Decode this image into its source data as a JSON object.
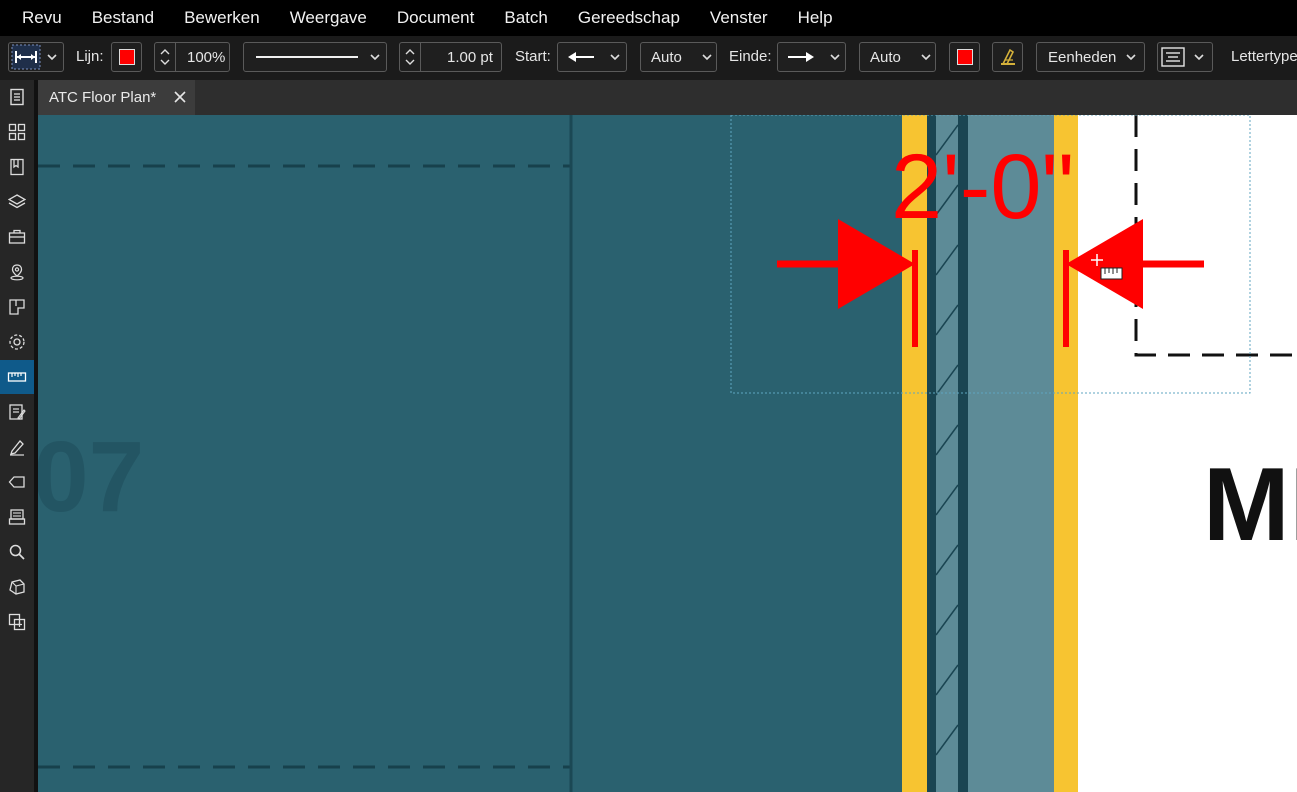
{
  "menubar": {
    "items": [
      "Revu",
      "Bestand",
      "Bewerken",
      "Weergave",
      "Document",
      "Batch",
      "Gereedschap",
      "Venster",
      "Help"
    ]
  },
  "toolbar": {
    "line_label": "Lijn:",
    "line_color": "#ff0000",
    "opacity": "100%",
    "line_width": "1.00 pt",
    "start_label": "Start:",
    "start_auto": "Auto",
    "end_label": "Einde:",
    "end_auto": "Auto",
    "fill_color": "#ff0000",
    "units_label": "Eenheden",
    "font_label": "Lettertype"
  },
  "tab": {
    "title": "ATC Floor Plan*"
  },
  "drawing": {
    "room_number": "07",
    "room_label": "MI",
    "dimension_text": "2'-0\"",
    "dimension_color": "#ff0000",
    "room_fill": "#2a616f",
    "wall_yellow": "#f7c431"
  },
  "siderail": {
    "icons": [
      "properties-icon",
      "thumbnails-icon",
      "bookmarks-icon",
      "layers-icon",
      "toolchest-icon",
      "places-icon",
      "spaces-icon",
      "settings-icon",
      "measurements-icon",
      "markups-list-icon",
      "signatures-icon",
      "tags-icon",
      "stamps-icon",
      "search-icon",
      "3d-icon",
      "compare-icon"
    ],
    "active": "measurements-icon"
  }
}
